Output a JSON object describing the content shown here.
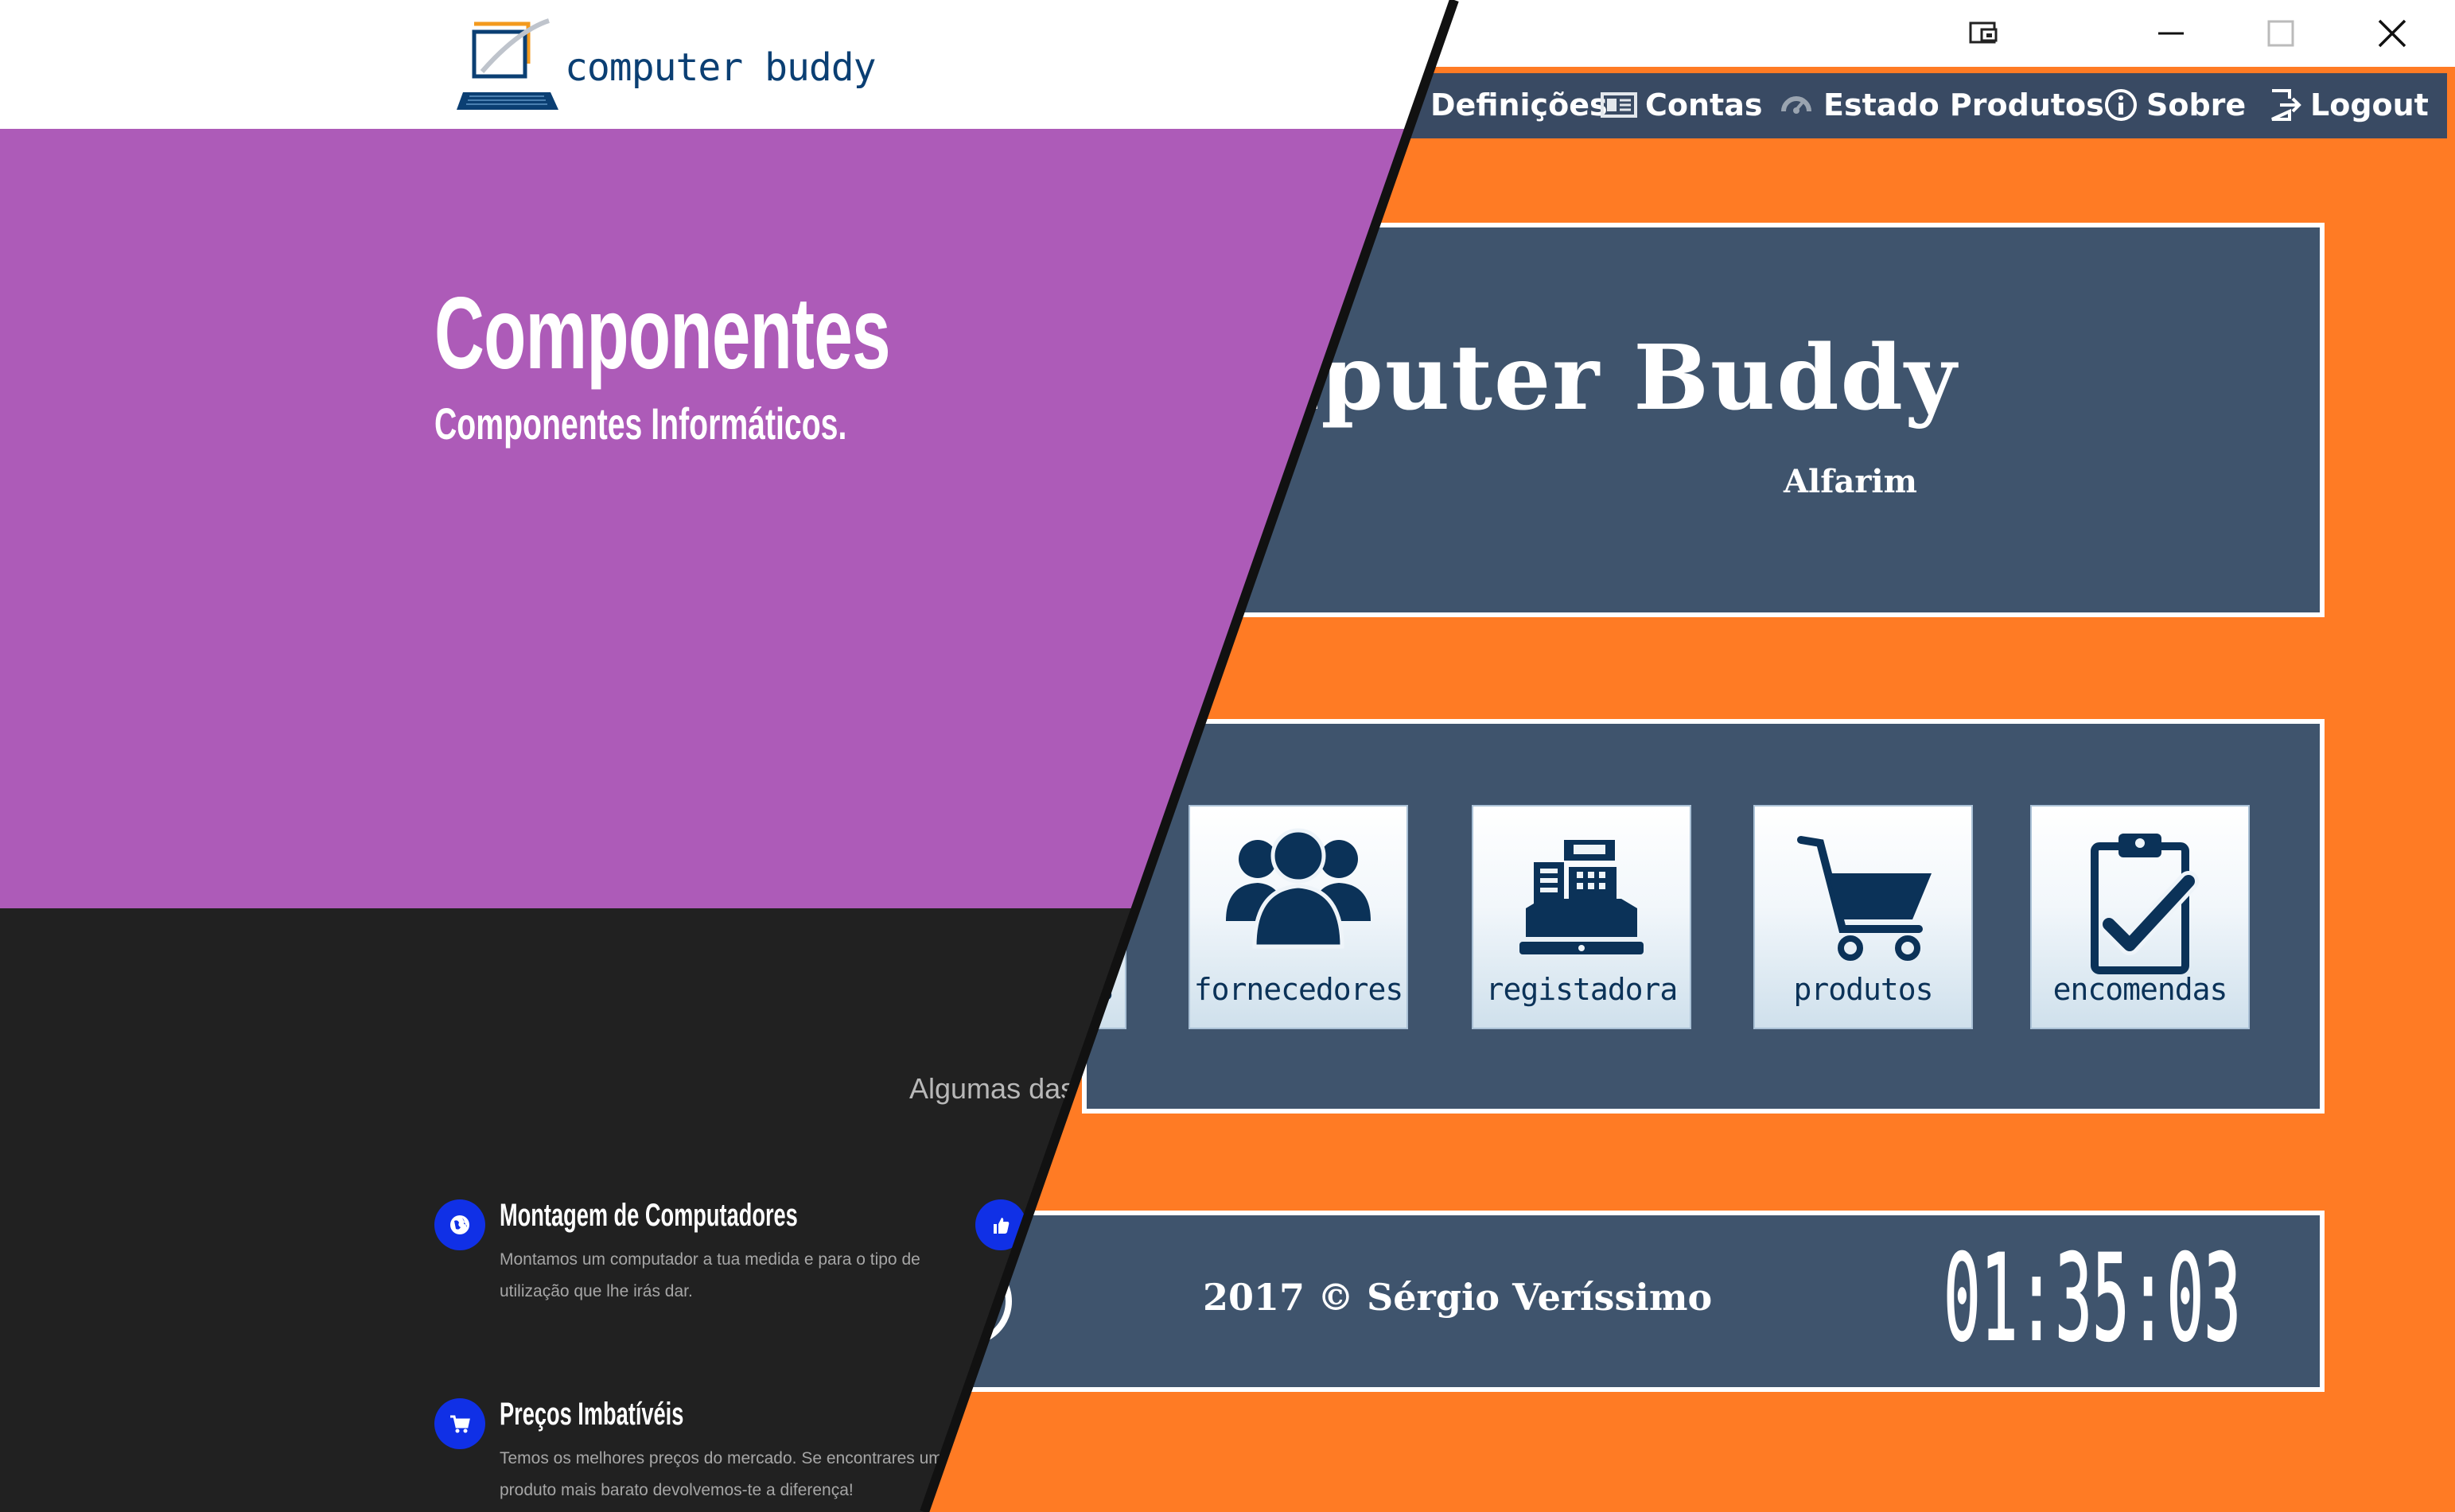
{
  "website": {
    "logo_text": "computer buddy",
    "hero_title": "Componentes",
    "hero_subtitle": "Componentes Informáticos.",
    "section_heading": "Algumas das",
    "features": [
      {
        "title": "Montagem de Computadores",
        "text": "Montamos um computador a tua medida e para o tipo de utilização que lhe irás dar.",
        "icon": "globe-icon"
      },
      {
        "title": "Preços Imbatívéis",
        "text": "Temos os melhores preços do mercado. Se encontrares um produto mais barato devolvemos-te a diferença!",
        "icon": "cart-icon"
      }
    ]
  },
  "desktop": {
    "menu": [
      {
        "label": "Definições",
        "icon": "settings-icon"
      },
      {
        "label": "Contas",
        "icon": "accounts-icon"
      },
      {
        "label": "Estado Produtos",
        "icon": "product-status-icon"
      },
      {
        "label": "Sobre",
        "icon": "info-icon"
      },
      {
        "label": "Logout",
        "icon": "logout-icon"
      }
    ],
    "app_title": "mputer Buddy",
    "app_subtitle": "Alfarim",
    "tiles": [
      {
        "label": "s"
      },
      {
        "label": "fornecedores"
      },
      {
        "label": "registadora"
      },
      {
        "label": "produtos"
      },
      {
        "label": "encomendas"
      }
    ],
    "footer_text": "2017 © Sérgio Veríssimo",
    "clock": "01:35:03"
  },
  "colors": {
    "hero_purple": "#ad5bb8",
    "dark_bg": "#212121",
    "feature_icon_blue": "#1030e6",
    "desktop_orange": "#ff7b24",
    "panel_slate": "#3f546d",
    "menubar": "#394a63"
  }
}
